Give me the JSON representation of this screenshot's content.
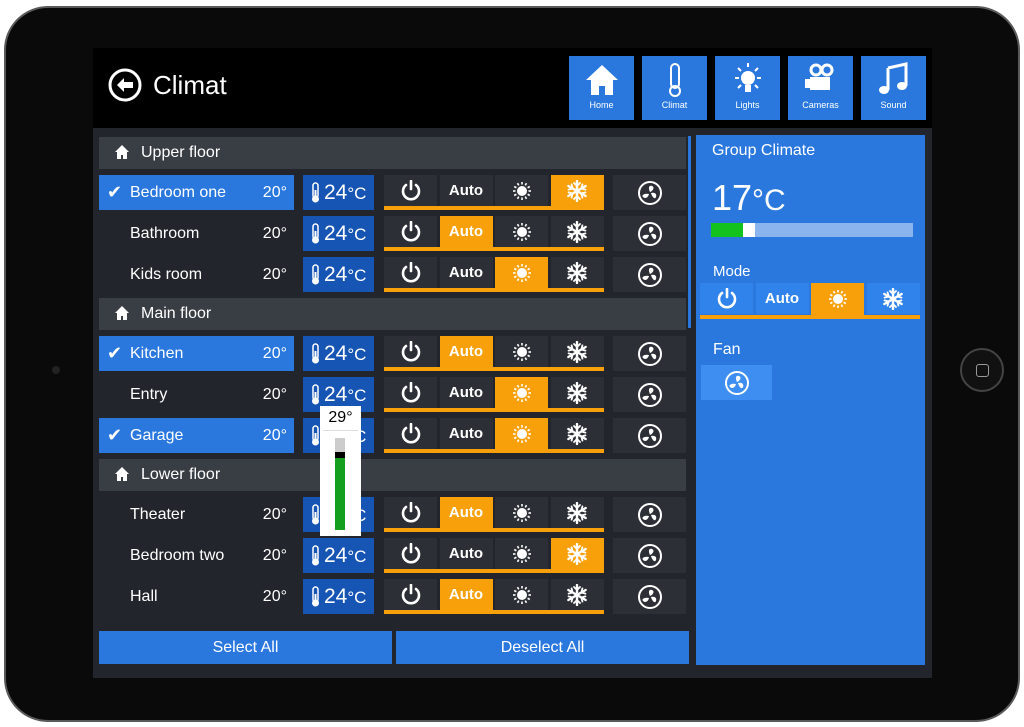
{
  "header": {
    "title": "Climat"
  },
  "nav": [
    {
      "label": "Home",
      "icon": "home-icon"
    },
    {
      "label": "Climat",
      "icon": "thermometer-icon"
    },
    {
      "label": "Lights",
      "icon": "lightbulb-icon"
    },
    {
      "label": "Cameras",
      "icon": "camera-icon"
    },
    {
      "label": "Sound",
      "icon": "music-icon"
    }
  ],
  "groups": [
    {
      "label": "Upper floor",
      "rooms": [
        {
          "name": "Bedroom one",
          "current": "20°",
          "setpoint": "24",
          "unit": "°C",
          "selected": true,
          "mode": "cool"
        },
        {
          "name": "Bathroom",
          "current": "20°",
          "setpoint": "24",
          "unit": "°C",
          "selected": false,
          "mode": "auto"
        },
        {
          "name": "Kids room",
          "current": "20°",
          "setpoint": "24",
          "unit": "°C",
          "selected": false,
          "mode": "heat"
        }
      ]
    },
    {
      "label": "Main floor",
      "rooms": [
        {
          "name": "Kitchen",
          "current": "20°",
          "setpoint": "24",
          "unit": "°C",
          "selected": true,
          "mode": "auto"
        },
        {
          "name": "Entry",
          "current": "20°",
          "setpoint": "24",
          "unit": "°C",
          "selected": false,
          "mode": "heat"
        },
        {
          "name": "Garage",
          "current": "20°",
          "setpoint": "24",
          "unit": "°C",
          "selected": true,
          "mode": "heat"
        }
      ]
    },
    {
      "label": "Lower floor",
      "rooms": [
        {
          "name": "Theater",
          "current": "20°",
          "setpoint": "24",
          "unit": "°C",
          "selected": false,
          "mode": "auto"
        },
        {
          "name": "Bedroom two",
          "current": "20°",
          "setpoint": "24",
          "unit": "°C",
          "selected": false,
          "mode": "cool"
        },
        {
          "name": "Hall",
          "current": "20°",
          "setpoint": "24",
          "unit": "°C",
          "selected": false,
          "mode": "auto"
        }
      ]
    }
  ],
  "mode_labels": {
    "auto": "Auto"
  },
  "tooltip": {
    "value": "29°",
    "level_percent": 85
  },
  "actions": {
    "select_all": "Select All",
    "deselect_all": "Deselect All"
  },
  "group_climate": {
    "title": "Group Climate",
    "temp": "17",
    "unit": "°C",
    "level_percent": 16,
    "mode_label": "Mode",
    "mode": "heat",
    "fan_label": "Fan"
  },
  "colors": {
    "accent": "#2a78de",
    "active": "#f7a00a",
    "setpoint": "#1655b3",
    "panel": "#22262c"
  }
}
